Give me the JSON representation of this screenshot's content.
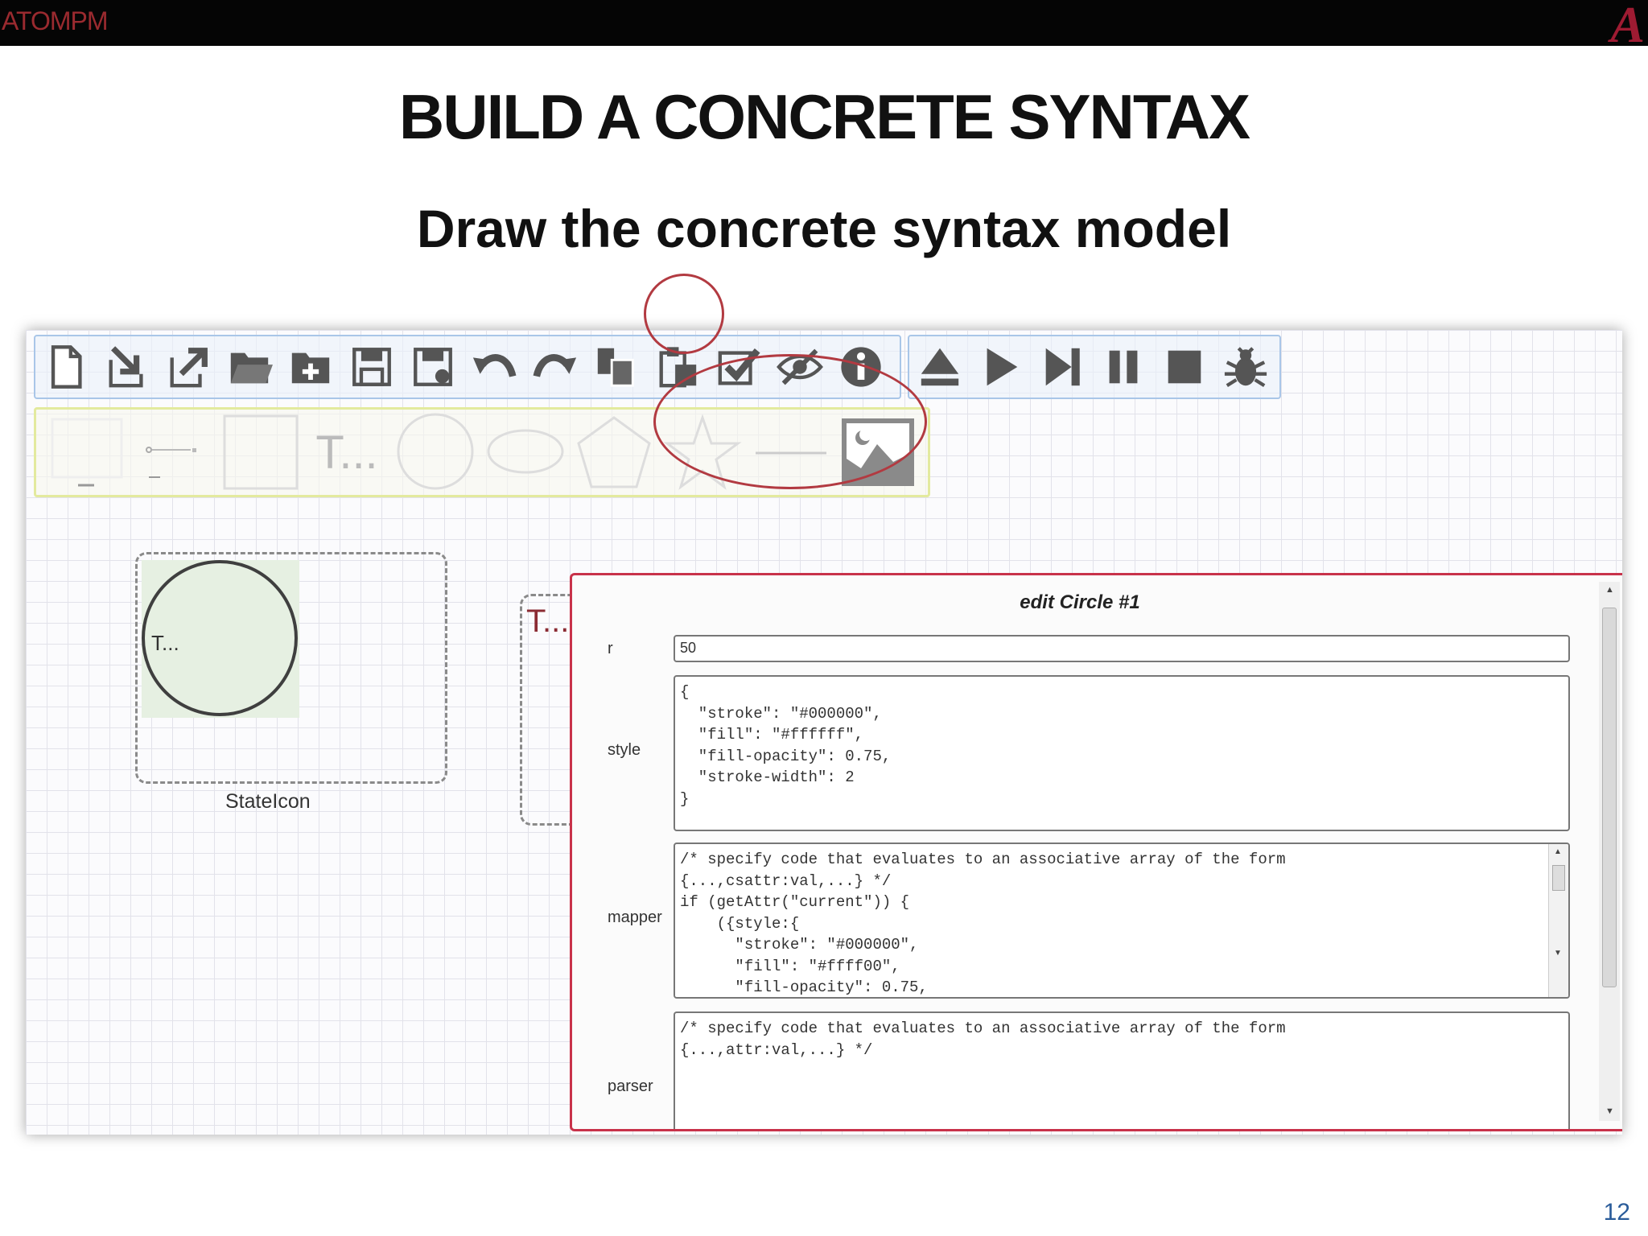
{
  "header": {
    "logo": "ATOMPM",
    "title": "BUILD A CONCRETE SYNTAX",
    "subtitle": "Draw the concrete syntax model",
    "page_number": "12"
  },
  "toolbar_main": [
    "new-file-icon",
    "import-icon",
    "export-icon",
    "open-folder-icon",
    "new-folder-icon",
    "save-icon",
    "save-as-icon",
    "undo-icon",
    "redo-icon",
    "copy-icon",
    "paste-icon",
    "validate-icon",
    "hide-icon",
    "info-icon"
  ],
  "toolbar_run": [
    "eject-icon",
    "play-icon",
    "step-icon",
    "pause-icon",
    "stop-icon",
    "debug-icon"
  ],
  "palette": {
    "text_tool_label": "T...",
    "items": [
      "rectangle-tool",
      "link-tool",
      "square-tool",
      "text-tool",
      "circle-tool",
      "ellipse-tool",
      "pentagon-tool",
      "star-tool",
      "line-tool",
      "image-tool"
    ]
  },
  "canvas": {
    "circle_text": "T...",
    "stateicon_label": "StateIcon",
    "text_box_label": "T..."
  },
  "dialog": {
    "title": "edit Circle #1",
    "r": {
      "label": "r",
      "value": "50"
    },
    "style": {
      "label": "style",
      "value": "{\n  \"stroke\": \"#000000\",\n  \"fill\": \"#ffffff\",\n  \"fill-opacity\": 0.75,\n  \"stroke-width\": 2\n}"
    },
    "mapper": {
      "label": "mapper",
      "value": "/* specify code that evaluates to an associative array of the form\n{...,csattr:val,...} */\nif (getAttr(\"current\")) {\n    ({style:{\n      \"stroke\": \"#000000\",\n      \"fill\": \"#ffff00\",\n      \"fill-opacity\": 0.75,"
    },
    "parser": {
      "label": "parser",
      "value": "/* specify code that evaluates to an associative array of the form\n{...,attr:val,...} */"
    }
  },
  "colors": {
    "accent_red": "#c8324a",
    "annotation": "#b23a41",
    "toolbar_border": "#a9c6e8",
    "palette_border": "#e3ea9e"
  }
}
